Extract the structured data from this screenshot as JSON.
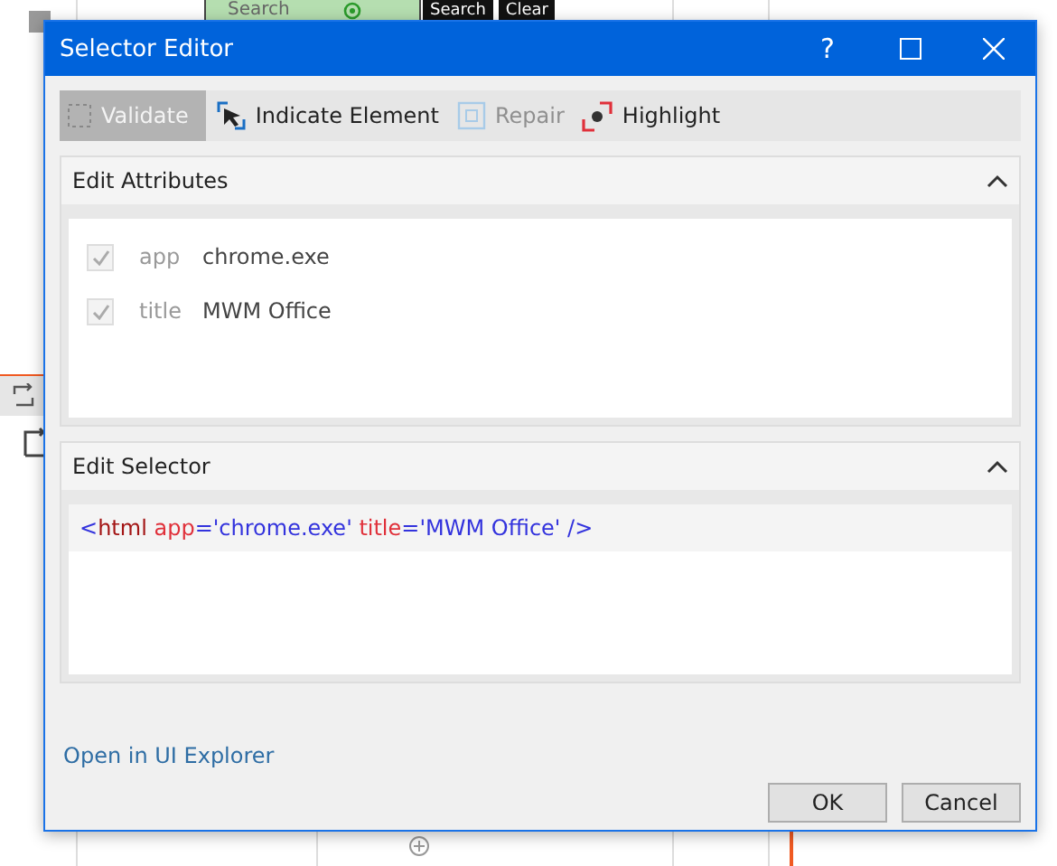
{
  "background": {
    "search_field": {
      "placeholder": "Search"
    },
    "buttons": [
      "Search",
      "Clear"
    ]
  },
  "window": {
    "title": "Selector Editor",
    "controls": [
      {
        "kind": "help",
        "label": "?"
      },
      {
        "kind": "maximize"
      },
      {
        "kind": "close"
      }
    ]
  },
  "toolbar": [
    {
      "kind": "validate",
      "label": "Validate",
      "disabled": true,
      "pressed": true
    },
    {
      "kind": "indicate",
      "label": "Indicate Element",
      "disabled": false,
      "pressed": false
    },
    {
      "kind": "repair",
      "label": "Repair",
      "disabled": true,
      "pressed": false
    },
    {
      "kind": "highlight",
      "label": "Highlight",
      "disabled": false,
      "pressed": false
    }
  ],
  "edit_attributes": {
    "title": "Edit Attributes",
    "expanded": true,
    "attributes": [
      {
        "name": "app",
        "value": "chrome.exe",
        "checked": true
      },
      {
        "name": "title",
        "value": "MWM Office",
        "checked": true
      }
    ]
  },
  "edit_selector": {
    "title": "Edit Selector",
    "expanded": true,
    "tokens": [
      {
        "kind": "punct",
        "text": "<"
      },
      {
        "kind": "tag",
        "text": "html"
      },
      {
        "kind": "attr",
        "text": " app"
      },
      {
        "kind": "punct",
        "text": "="
      },
      {
        "kind": "value",
        "text": "'chrome.exe'"
      },
      {
        "kind": "attr",
        "text": " title"
      },
      {
        "kind": "punct",
        "text": "="
      },
      {
        "kind": "value",
        "text": "'MWM Office'"
      },
      {
        "kind": "punct",
        "text": " />"
      }
    ]
  },
  "link": "Open in UI Explorer",
  "buttons": [
    "OK",
    "Cancel"
  ]
}
